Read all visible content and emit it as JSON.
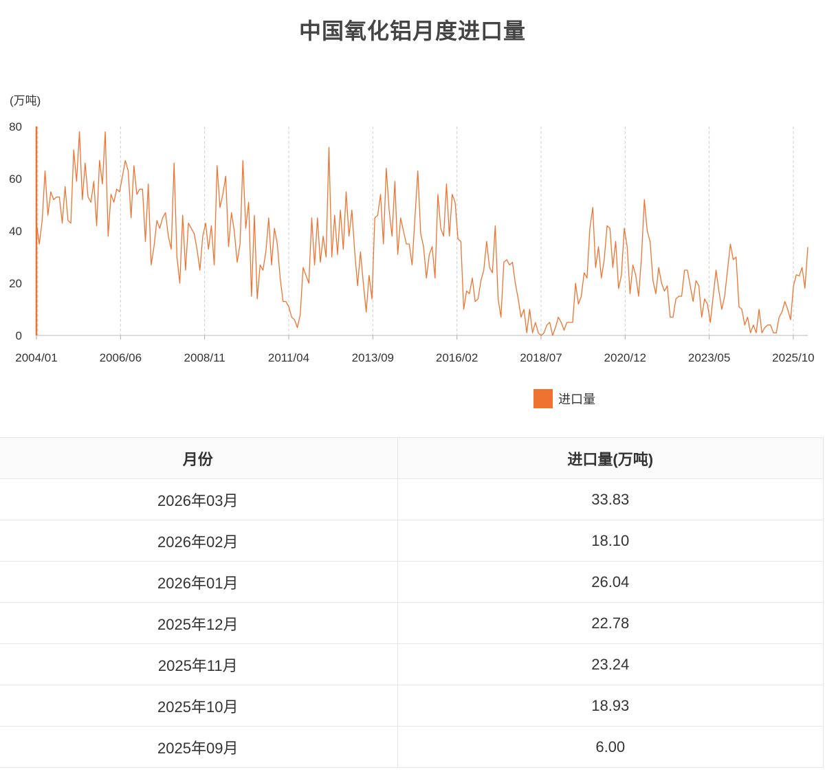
{
  "chart_data": {
    "type": "line",
    "title": "中国氧化铝月度进口量",
    "ylabel": "(万吨)",
    "ylim": [
      0,
      80
    ],
    "y_ticks": [
      "0",
      "20",
      "40",
      "60",
      "80"
    ],
    "x_start": "2004/01",
    "x_end": "2026/03",
    "x_ticks": [
      "2004/01",
      "2006/06",
      "2008/11",
      "2011/04",
      "2013/09",
      "2016/02",
      "2018/07",
      "2020/12",
      "2023/05",
      "2025/10"
    ],
    "grid": "vertical dashed",
    "legend_position": "bottom-right",
    "series": [
      {
        "name": "进口量",
        "color": "#ee7330",
        "values": [
          43,
          35,
          44,
          63,
          46,
          55,
          52,
          53,
          53,
          43,
          57,
          44,
          43,
          71,
          59,
          78,
          52,
          66,
          53,
          51,
          59,
          42,
          67,
          58,
          78,
          38,
          54,
          51,
          56,
          55,
          61,
          67,
          63,
          45,
          65,
          54,
          56,
          56,
          36,
          58,
          27,
          34,
          44,
          41,
          45,
          47,
          38,
          33,
          66,
          30,
          20,
          46,
          25,
          43,
          41,
          39,
          33,
          25,
          38,
          43,
          33,
          42,
          27,
          65,
          49,
          54,
          61,
          34,
          47,
          40,
          28,
          35,
          67,
          41,
          51,
          15,
          46,
          14,
          27,
          25,
          32,
          45,
          27,
          41,
          35,
          22,
          13,
          13,
          11,
          7,
          6,
          3,
          8,
          26,
          23,
          20,
          45,
          27,
          45,
          28,
          38,
          30,
          72,
          30,
          46,
          31,
          48,
          33,
          55,
          38,
          48,
          32,
          19,
          32,
          20,
          9,
          23,
          14,
          45,
          46,
          54,
          35,
          64,
          48,
          38,
          59,
          31,
          45,
          40,
          35,
          35,
          27,
          45,
          63,
          39,
          34,
          22,
          31,
          34,
          22,
          54,
          41,
          38,
          58,
          38,
          54,
          51,
          37,
          36,
          10,
          17,
          16,
          22,
          13,
          14,
          21,
          25,
          36,
          26,
          24,
          42,
          14,
          7,
          28,
          29,
          27,
          28,
          20,
          14,
          7,
          10,
          1,
          10,
          1,
          5,
          1,
          0,
          1,
          4,
          5,
          0,
          3,
          7,
          5,
          2,
          5,
          5,
          5,
          20,
          12,
          15,
          24,
          22,
          41,
          49,
          26,
          34,
          22,
          29,
          42,
          41,
          26,
          36,
          18,
          23,
          41,
          34,
          16,
          27,
          23,
          15,
          30,
          52,
          40,
          36,
          21,
          16,
          26,
          20,
          17,
          19,
          7,
          7,
          14,
          15,
          15,
          25,
          25,
          19,
          13,
          21,
          19,
          7,
          14,
          12,
          5,
          15,
          25,
          17,
          10,
          15,
          25,
          35,
          29,
          30,
          11,
          10,
          4,
          7,
          1,
          4,
          1,
          10,
          1,
          3,
          4,
          4,
          1,
          1,
          7,
          9,
          13,
          10,
          6,
          18.93,
          23.24,
          22.78,
          26.04,
          18.1,
          33.83
        ]
      }
    ]
  },
  "table": {
    "headers": [
      "月份",
      "进口量(万吨)"
    ],
    "rows": [
      {
        "month": "2026年03月",
        "value": "33.83"
      },
      {
        "month": "2026年02月",
        "value": "18.10"
      },
      {
        "month": "2026年01月",
        "value": "26.04"
      },
      {
        "month": "2025年12月",
        "value": "22.78"
      },
      {
        "month": "2025年11月",
        "value": "23.24"
      },
      {
        "month": "2025年10月",
        "value": "18.93"
      },
      {
        "month": "2025年09月",
        "value": "6.00"
      }
    ]
  }
}
